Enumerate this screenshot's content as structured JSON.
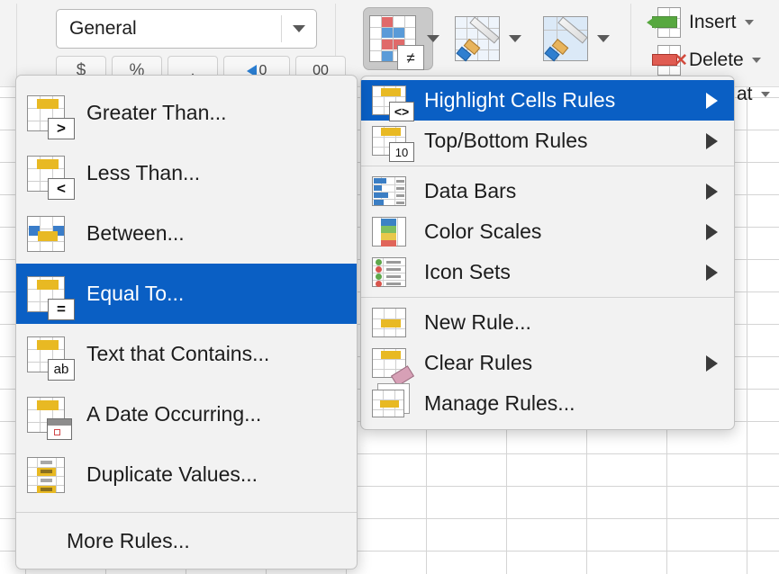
{
  "ribbon": {
    "number_format": {
      "value": "General",
      "dropdown_icon": "chevron-down-icon"
    },
    "number_buttons": [
      {
        "name": "currency-format-button",
        "label": "$"
      },
      {
        "name": "percent-format-button",
        "label": "%"
      },
      {
        "name": "comma-format-button",
        "label": ","
      },
      {
        "name": "increase-decimal-button",
        "label": "0"
      },
      {
        "name": "decrease-decimal-button",
        "label": "00"
      }
    ],
    "conditional_formatting": {
      "name": "conditional-formatting-button",
      "icon": "conditional-formatting-icon",
      "badge": "≠",
      "state": "pressed"
    },
    "format_as_table": {
      "name": "format-as-table-button",
      "icon": "format-as-table-icon"
    },
    "cell_styles": {
      "name": "cell-styles-button",
      "icon": "cell-styles-icon"
    },
    "insert": {
      "label": "Insert",
      "icon": "insert-cells-icon"
    },
    "delete": {
      "label": "Delete",
      "icon": "delete-cells-icon"
    },
    "format": {
      "label": "at",
      "full_label": "Format",
      "icon": "format-cells-icon"
    }
  },
  "highlight_menu": {
    "name": "highlight-cells-rules-submenu",
    "items": [
      {
        "label": "Greater Than...",
        "icon": "greater-than-icon",
        "badge": ">",
        "selected": false
      },
      {
        "label": "Less Than...",
        "icon": "less-than-icon",
        "badge": "<",
        "selected": false
      },
      {
        "label": "Between...",
        "icon": "between-icon",
        "badge": "",
        "selected": false
      },
      {
        "label": "Equal To...",
        "icon": "equal-to-icon",
        "badge": "=",
        "selected": true
      },
      {
        "label": "Text that Contains...",
        "icon": "text-contains-icon",
        "badge": "ab",
        "selected": false
      },
      {
        "label": "A Date Occurring...",
        "icon": "date-occurring-icon",
        "badge": "",
        "selected": false
      },
      {
        "label": "Duplicate Values...",
        "icon": "duplicate-values-icon",
        "badge": "",
        "selected": false
      }
    ],
    "footer": {
      "label": "More Rules...",
      "name": "more-rules-item"
    }
  },
  "conditional_menu": {
    "name": "conditional-formatting-menu",
    "group1": [
      {
        "label": "Highlight Cells Rules",
        "icon": "highlight-cells-rules-icon",
        "badge": "<>",
        "submenu": true,
        "selected": true
      },
      {
        "label": "Top/Bottom Rules",
        "icon": "top-bottom-rules-icon",
        "badge": "10",
        "submenu": true,
        "selected": false
      }
    ],
    "group2": [
      {
        "label": "Data Bars",
        "icon": "data-bars-icon",
        "submenu": true,
        "selected": false
      },
      {
        "label": "Color Scales",
        "icon": "color-scales-icon",
        "submenu": true,
        "selected": false
      },
      {
        "label": "Icon Sets",
        "icon": "icon-sets-icon",
        "submenu": true,
        "selected": false
      }
    ],
    "group3": [
      {
        "label": "New Rule...",
        "icon": "new-rule-icon",
        "submenu": false,
        "selected": false
      },
      {
        "label": "Clear Rules",
        "icon": "clear-rules-icon",
        "submenu": true,
        "selected": false
      },
      {
        "label": "Manage Rules...",
        "icon": "manage-rules-icon",
        "submenu": false,
        "selected": false
      }
    ]
  },
  "colors": {
    "selection_blue": "#0a5fc4",
    "menu_background": "#f2f2f2",
    "accent_yellow": "#e8b923",
    "accent_blue": "#3a7dc9",
    "grid_line": "#d4d4d4"
  }
}
